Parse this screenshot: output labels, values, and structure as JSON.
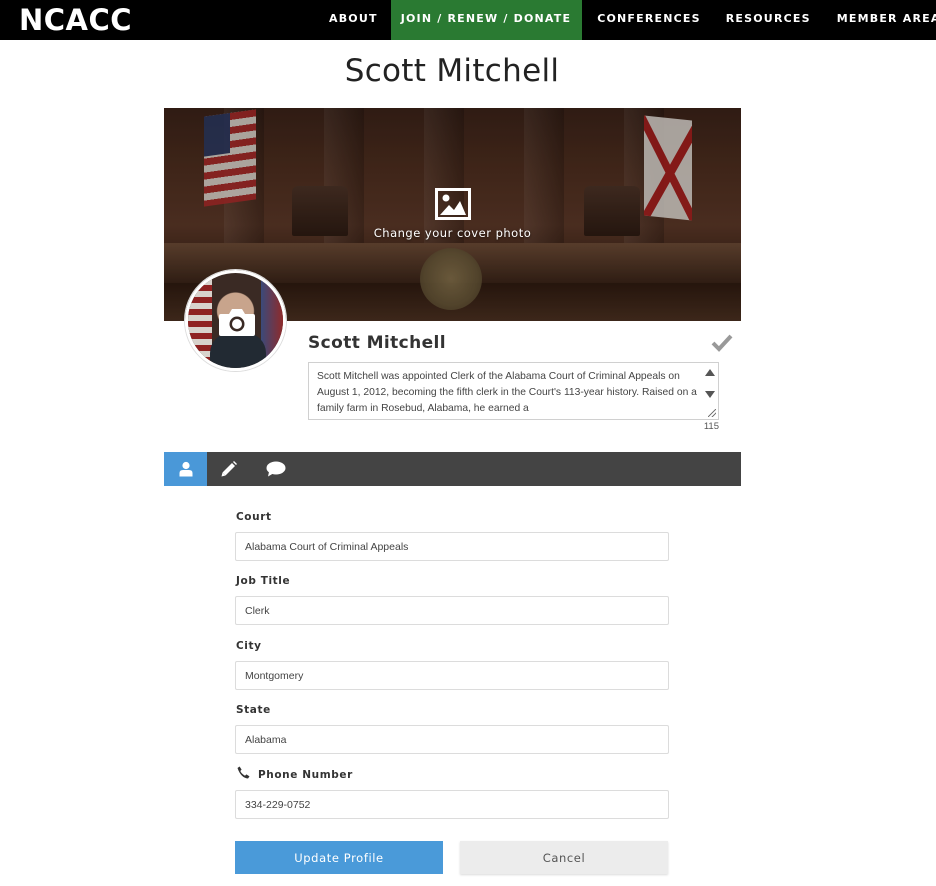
{
  "header": {
    "logo": "NCACC",
    "nav": [
      {
        "label": "ABOUT"
      },
      {
        "label": "JOIN / RENEW / DONATE"
      },
      {
        "label": "CONFERENCES"
      },
      {
        "label": "RESOURCES"
      },
      {
        "label": "MEMBER AREA"
      }
    ]
  },
  "page": {
    "title": "Scott Mitchell"
  },
  "cover": {
    "cta": "Change your cover photo"
  },
  "profile": {
    "name": "Scott Mitchell",
    "bio": "Scott Mitchell was appointed Clerk of the Alabama Court of Criminal Appeals on August 1, 2012, becoming the fifth clerk in the Court's 113-year history. Raised on a family farm in Rosebud, Alabama, he earned a",
    "char_count": "115"
  },
  "tabs": [
    {
      "icon": "user-icon"
    },
    {
      "icon": "pencil-icon"
    },
    {
      "icon": "comment-icon"
    }
  ],
  "form": {
    "court": {
      "label": "Court",
      "value": "Alabama Court of Criminal Appeals"
    },
    "job_title": {
      "label": "Job Title",
      "value": "Clerk"
    },
    "city": {
      "label": "City",
      "value": "Montgomery"
    },
    "state": {
      "label": "State",
      "value": "Alabama"
    },
    "phone": {
      "label": "Phone Number",
      "value": "334-229-0752"
    }
  },
  "actions": {
    "submit": "Update Profile",
    "cancel": "Cancel"
  },
  "colors": {
    "nav_active": "#2a7a32",
    "accent": "#4a9ad9",
    "tabbar": "#444444"
  }
}
